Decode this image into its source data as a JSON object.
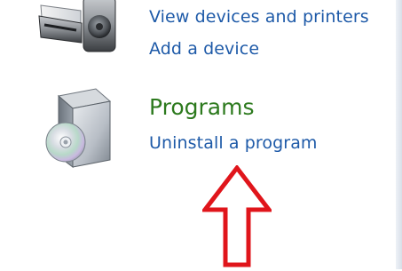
{
  "devices": {
    "view_label": "View devices and printers",
    "add_label": "Add a device",
    "icon": "printer-icon"
  },
  "programs": {
    "heading": "Programs",
    "uninstall_label": "Uninstall a program",
    "icon": "software-box-icon"
  },
  "annotation": {
    "icon": "up-arrow-icon",
    "color": "#e0151b"
  },
  "colors": {
    "link": "#1e5aa8",
    "heading": "#2d7a1e"
  }
}
